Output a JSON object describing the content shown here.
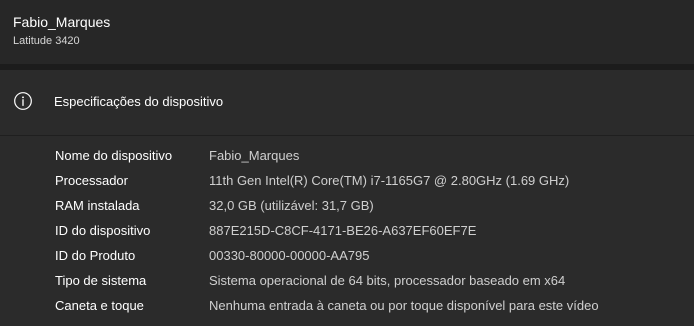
{
  "device": {
    "name": "Fabio_Marques",
    "model": "Latitude 3420"
  },
  "specs": {
    "title": "Especificações do dispositivo",
    "icon": "info-icon",
    "rows": [
      {
        "label": "Nome do dispositivo",
        "value": "Fabio_Marques"
      },
      {
        "label": "Processador",
        "value": "11th Gen Intel(R) Core(TM) i7-1165G7 @ 2.80GHz (1.69 GHz)"
      },
      {
        "label": "RAM instalada",
        "value": "32,0 GB (utilizável: 31,7 GB)"
      },
      {
        "label": "ID do dispositivo",
        "value": "887E215D-C8CF-4171-BE26-A637EF60EF7E"
      },
      {
        "label": "ID do Produto",
        "value": "00330-80000-00000-AA795"
      },
      {
        "label": "Tipo de sistema",
        "value": "Sistema operacional de 64 bits, processador baseado em x64"
      },
      {
        "label": "Caneta e toque",
        "value": "Nenhuma entrada à caneta ou por toque disponível para este vídeo"
      }
    ]
  }
}
